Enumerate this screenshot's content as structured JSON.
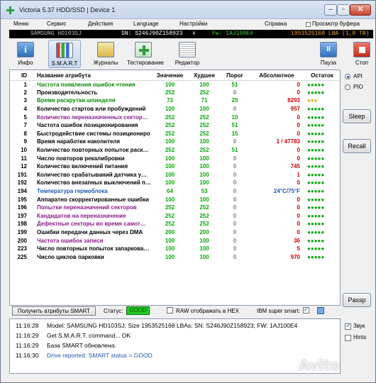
{
  "window": {
    "title": "Victoria 5.37 HDD/SSD | Device 1"
  },
  "menu": [
    "Меню",
    "Сервис",
    "Действия",
    "Language",
    "Настройки",
    "Справка",
    "Просмотр буфера"
  ],
  "device": {
    "model": "SAMSUNG HD103SJ",
    "serial": "SN: S246J90Z158923",
    "close_mark": "x",
    "firmware": "Fw: 1AJ100E4",
    "lba": "1953525168 LBA (1,0 TB)"
  },
  "toolbar": {
    "info": "Инфо",
    "smart": "S.M.A.R.T",
    "journals": "Журналы",
    "testing": "Тестирование",
    "editor": "Редактор",
    "pause": "Пауза",
    "stop": "Стоп"
  },
  "table": {
    "headers": [
      "ID",
      "Название атрибута",
      "Значение",
      "Худшее",
      "Порог",
      "Абсолютное",
      "Остаток"
    ],
    "rows": [
      {
        "id": "1",
        "name": "Частота появления ошибок чтения",
        "value": "100",
        "worst": "100",
        "threshold": "51",
        "raw": "0",
        "rest": "●●●●●",
        "name_color": "#0a8a0a",
        "val_color": "#0aa80a",
        "thr_color": "#0aa80a",
        "raw_color": "#d00000",
        "rest_color": "#0aa80a"
      },
      {
        "id": "2",
        "name": "Производительность",
        "value": "252",
        "worst": "252",
        "threshold": "0",
        "raw": "0",
        "rest": "●●●●●",
        "name_color": "#000000",
        "val_color": "#0aa80a",
        "thr_color": "#808080",
        "raw_color": "#d00000",
        "rest_color": "#0aa80a"
      },
      {
        "id": "3",
        "name": "Время раскрутки шпинделя",
        "value": "73",
        "worst": "71",
        "threshold": "25",
        "raw": "8293",
        "rest": "●●●",
        "name_color": "#0a8a0a",
        "val_color": "#0aa80a",
        "thr_color": "#0aa80a",
        "raw_color": "#d00000",
        "rest_color": "#e0b000"
      },
      {
        "id": "4",
        "name": "Количество стартов или пробуждений",
        "value": "100",
        "worst": "100",
        "threshold": "0",
        "raw": "957",
        "rest": "●●●●●",
        "name_color": "#000000",
        "val_color": "#0aa80a",
        "thr_color": "#808080",
        "raw_color": "#d00000",
        "rest_color": "#0aa80a"
      },
      {
        "id": "5",
        "name": "Количество переназначенных сектор…",
        "value": "252",
        "worst": "252",
        "threshold": "10",
        "raw": "0",
        "rest": "●●●●●",
        "name_color": "#8a1a8a",
        "val_color": "#0aa80a",
        "thr_color": "#0aa80a",
        "raw_color": "#d00000",
        "rest_color": "#0aa80a"
      },
      {
        "id": "7",
        "name": "Частота ошибок позиционирования",
        "value": "252",
        "worst": "252",
        "threshold": "51",
        "raw": "0",
        "rest": "●●●●●",
        "name_color": "#000000",
        "val_color": "#0aa80a",
        "thr_color": "#0aa80a",
        "raw_color": "#d00000",
        "rest_color": "#0aa80a"
      },
      {
        "id": "8",
        "name": "Быстродействие системы позициониро…",
        "value": "252",
        "worst": "252",
        "threshold": "15",
        "raw": "0",
        "rest": "●●●●●",
        "name_color": "#000000",
        "val_color": "#0aa80a",
        "thr_color": "#0aa80a",
        "raw_color": "#d00000",
        "rest_color": "#0aa80a"
      },
      {
        "id": "9",
        "name": "Время наработки накопителя",
        "value": "100",
        "worst": "100",
        "threshold": "0",
        "raw": "1 / 47783",
        "rest": "●●●●●",
        "name_color": "#000000",
        "val_color": "#0aa80a",
        "thr_color": "#808080",
        "raw_color": "#d00000",
        "rest_color": "#0aa80a"
      },
      {
        "id": "10",
        "name": "Количество повторных попыток раск…",
        "value": "252",
        "worst": "252",
        "threshold": "51",
        "raw": "0",
        "rest": "●●●●●",
        "name_color": "#000000",
        "val_color": "#0aa80a",
        "thr_color": "#0aa80a",
        "raw_color": "#d00000",
        "rest_color": "#0aa80a"
      },
      {
        "id": "11",
        "name": "Число повторов рекалибровки",
        "value": "100",
        "worst": "100",
        "threshold": "0",
        "raw": "0",
        "rest": "●●●●●",
        "name_color": "#000000",
        "val_color": "#0aa80a",
        "thr_color": "#808080",
        "raw_color": "#d00000",
        "rest_color": "#0aa80a"
      },
      {
        "id": "12",
        "name": "Количество включений питания",
        "value": "100",
        "worst": "100",
        "threshold": "0",
        "raw": "745",
        "rest": "●●●●●",
        "name_color": "#000000",
        "val_color": "#0aa80a",
        "thr_color": "#808080",
        "raw_color": "#d00000",
        "rest_color": "#0aa80a"
      },
      {
        "id": "191",
        "name": "Количество срабатываний датчика у…",
        "value": "100",
        "worst": "100",
        "threshold": "0",
        "raw": "1",
        "rest": "●●●●●",
        "name_color": "#000000",
        "val_color": "#0aa80a",
        "thr_color": "#808080",
        "raw_color": "#d00000",
        "rest_color": "#0aa80a"
      },
      {
        "id": "192",
        "name": "Количество внезапных выключений п…",
        "value": "100",
        "worst": "100",
        "threshold": "0",
        "raw": "0",
        "rest": "●●●●●",
        "name_color": "#000000",
        "val_color": "#0aa80a",
        "thr_color": "#808080",
        "raw_color": "#d00000",
        "rest_color": "#0aa80a"
      },
      {
        "id": "194",
        "name": "Температура гермоблока",
        "value": "64",
        "worst": "53",
        "threshold": "0",
        "raw": "24°C/75°F",
        "rest": "●●●●●",
        "name_color": "#1c57b5",
        "val_color": "#0aa80a",
        "thr_color": "#808080",
        "raw_color": "#1c57b5",
        "rest_color": "#0aa80a"
      },
      {
        "id": "195",
        "name": "Аппаратно скорректированные ошибки",
        "value": "100",
        "worst": "100",
        "threshold": "0",
        "raw": "0",
        "rest": "●●●●●",
        "name_color": "#000000",
        "val_color": "#0aa80a",
        "thr_color": "#808080",
        "raw_color": "#d00000",
        "rest_color": "#0aa80a"
      },
      {
        "id": "196",
        "name": "Попытки переназначений секторов",
        "value": "252",
        "worst": "252",
        "threshold": "0",
        "raw": "0",
        "rest": "●●●●●",
        "name_color": "#8a1a8a",
        "val_color": "#0aa80a",
        "thr_color": "#808080",
        "raw_color": "#d00000",
        "rest_color": "#0aa80a"
      },
      {
        "id": "197",
        "name": "Кандидатов на переназначение",
        "value": "252",
        "worst": "252",
        "threshold": "0",
        "raw": "0",
        "rest": "●●●●●",
        "name_color": "#8a1a8a",
        "val_color": "#0aa80a",
        "thr_color": "#808080",
        "raw_color": "#d00000",
        "rest_color": "#0aa80a"
      },
      {
        "id": "198",
        "name": "Дефектные секторы во время самот…",
        "value": "252",
        "worst": "252",
        "threshold": "0",
        "raw": "0",
        "rest": "●●●●●",
        "name_color": "#8a1a8a",
        "val_color": "#0aa80a",
        "thr_color": "#808080",
        "raw_color": "#d00000",
        "rest_color": "#0aa80a"
      },
      {
        "id": "199",
        "name": "Ошибки передачи данных через DMA",
        "value": "200",
        "worst": "200",
        "threshold": "0",
        "raw": "0",
        "rest": "●●●●●",
        "name_color": "#000000",
        "val_color": "#0aa80a",
        "thr_color": "#808080",
        "raw_color": "#d00000",
        "rest_color": "#0aa80a"
      },
      {
        "id": "200",
        "name": "Частота ошибок записи",
        "value": "100",
        "worst": "100",
        "threshold": "0",
        "raw": "36",
        "rest": "●●●●●",
        "name_color": "#8a1a8a",
        "val_color": "#0aa80a",
        "thr_color": "#808080",
        "raw_color": "#d00000",
        "rest_color": "#0aa80a"
      },
      {
        "id": "223",
        "name": "Число повторных попыток запаркова…",
        "value": "100",
        "worst": "100",
        "threshold": "0",
        "raw": "5",
        "rest": "●●●●●",
        "name_color": "#000000",
        "val_color": "#0aa80a",
        "thr_color": "#808080",
        "raw_color": "#d00000",
        "rest_color": "#0aa80a"
      },
      {
        "id": "225",
        "name": "Число циклов парковки",
        "value": "100",
        "worst": "100",
        "threshold": "0",
        "raw": "970",
        "rest": "●●●●●",
        "name_color": "#000000",
        "val_color": "#0aa80a",
        "thr_color": "#808080",
        "raw_color": "#d00000",
        "rest_color": "#0aa80a"
      }
    ]
  },
  "right_panel": {
    "api": "API",
    "pio": "PIO",
    "sleep": "Sleep",
    "recall": "Recall",
    "passp": "Passp"
  },
  "status_bar": {
    "get_attributes": "Получить атрибуты SMART",
    "status_label": "Статус:",
    "status_value": "GOOD",
    "status_color": "#22cc22",
    "raw_hex": "RAW отображать в HEX",
    "ibm_smart": "IBM super smart:"
  },
  "log": [
    {
      "time": "11:16:28",
      "msg": "Model: SAMSUNG HD103SJ; Size 1953525168 LBAs; SN: S246J90Z158923; FW: 1AJ100E4"
    },
    {
      "time": "11:16:29",
      "msg": "Get S.M.A.R.T. command... OK"
    },
    {
      "time": "11:16:29",
      "msg": "База SMART обновлена."
    },
    {
      "time": "11:16:30",
      "msg": "Drive reported: SMART status = GOOD"
    }
  ],
  "log_options": {
    "sound": "Звук",
    "hints": "Hints"
  },
  "watermark": "Avito"
}
